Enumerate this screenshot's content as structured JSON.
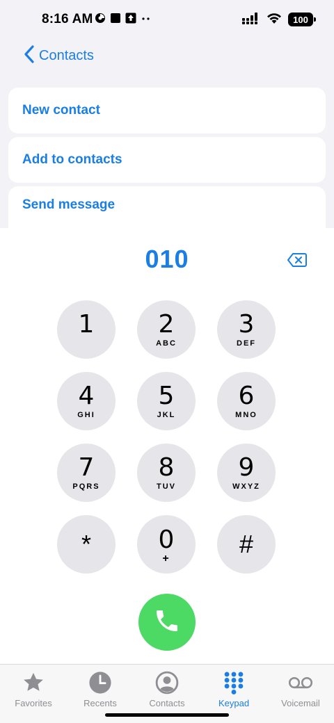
{
  "status_bar": {
    "time": "8:16 AM",
    "battery": "100",
    "icons": [
      "data-saver-icon",
      "stop-icon",
      "upload-icon",
      "more-dots-icon",
      "signal-icon",
      "wifi-icon",
      "battery-icon"
    ]
  },
  "nav": {
    "back_label": "Contacts"
  },
  "options": [
    {
      "label": "New contact"
    },
    {
      "label": "Add to contacts"
    },
    {
      "label": "Send message"
    }
  ],
  "dialer": {
    "number": "010"
  },
  "keypad": {
    "keys": [
      {
        "digit": "1",
        "letters": ""
      },
      {
        "digit": "2",
        "letters": "ABC"
      },
      {
        "digit": "3",
        "letters": "DEF"
      },
      {
        "digit": "4",
        "letters": "GHI"
      },
      {
        "digit": "5",
        "letters": "JKL"
      },
      {
        "digit": "6",
        "letters": "MNO"
      },
      {
        "digit": "7",
        "letters": "PQRS"
      },
      {
        "digit": "8",
        "letters": "TUV"
      },
      {
        "digit": "9",
        "letters": "WXYZ"
      },
      {
        "digit": "*",
        "letters": ""
      },
      {
        "digit": "0",
        "letters": "+"
      },
      {
        "digit": "#",
        "letters": ""
      }
    ]
  },
  "tabs": [
    {
      "label": "Favorites",
      "icon": "star-icon",
      "active": false
    },
    {
      "label": "Recents",
      "icon": "clock-icon",
      "active": false
    },
    {
      "label": "Contacts",
      "icon": "person-circle-icon",
      "active": false
    },
    {
      "label": "Keypad",
      "icon": "keypad-icon",
      "active": true
    },
    {
      "label": "Voicemail",
      "icon": "voicemail-icon",
      "active": false
    }
  ],
  "colors": {
    "accent": "#1a7ee5",
    "call_green": "#4cd964",
    "key_bg": "#e5e5ea",
    "inactive_gray": "#8e8e93"
  }
}
